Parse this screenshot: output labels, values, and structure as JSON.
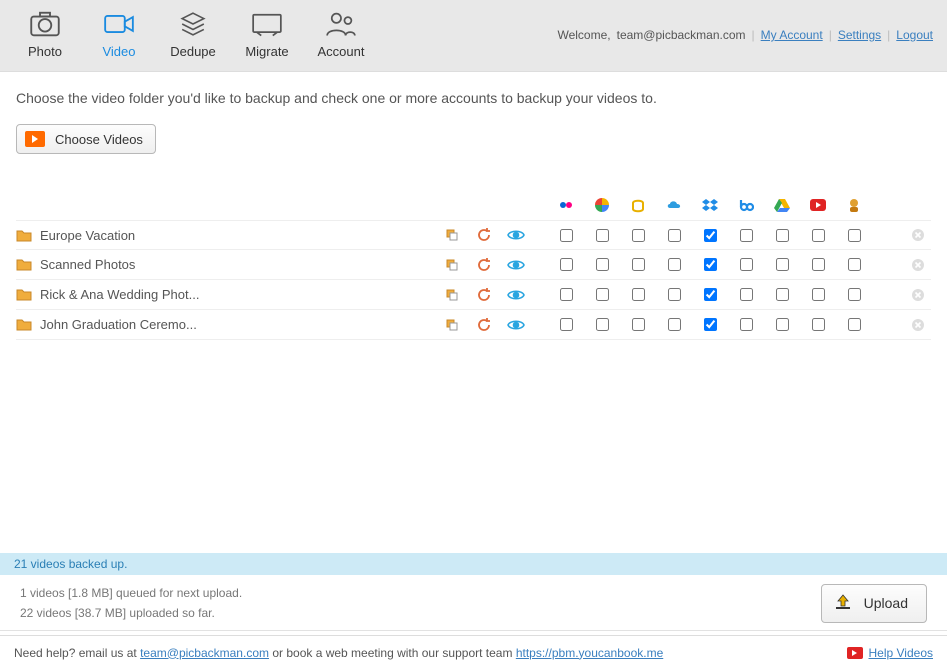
{
  "header": {
    "tabs": [
      {
        "label": "Photo"
      },
      {
        "label": "Video"
      },
      {
        "label": "Dedupe"
      },
      {
        "label": "Migrate"
      },
      {
        "label": "Account"
      }
    ],
    "welcome_prefix": "Welcome,",
    "welcome_email": "team@picbackman.com",
    "links": {
      "my_account": "My Account",
      "settings": "Settings",
      "logout": "Logout"
    }
  },
  "main": {
    "instruction": "Choose the video folder you'd like to backup and check one or more accounts to backup your videos to.",
    "choose_button": "Choose Videos"
  },
  "services": [
    "flickr",
    "google-photos",
    "smugmug",
    "onedrive",
    "dropbox",
    "box",
    "google-drive",
    "youtube",
    "other"
  ],
  "folders": [
    {
      "name": "Europe Vacation",
      "checks": [
        false,
        false,
        false,
        false,
        true,
        false,
        false,
        false,
        false
      ]
    },
    {
      "name": "Scanned Photos",
      "checks": [
        false,
        false,
        false,
        false,
        true,
        false,
        false,
        false,
        false
      ]
    },
    {
      "name": "Rick & Ana Wedding Phot...",
      "checks": [
        false,
        false,
        false,
        false,
        true,
        false,
        false,
        false,
        false
      ]
    },
    {
      "name": "John Graduation Ceremo...",
      "checks": [
        false,
        false,
        false,
        false,
        true,
        false,
        false,
        false,
        false
      ]
    }
  ],
  "status": {
    "strip": "21 videos backed up.",
    "queued": "1 videos [1.8 MB] queued for next upload.",
    "uploaded": "22 videos [38.7 MB] uploaded so far.",
    "upload_button": "Upload"
  },
  "footer": {
    "help_prefix": "Need help? email us at",
    "help_email": "team@picbackman.com",
    "help_mid": "or book a web meeting with our support team",
    "help_link": "https://pbm.youcanbook.me",
    "help_videos": "Help Videos"
  }
}
